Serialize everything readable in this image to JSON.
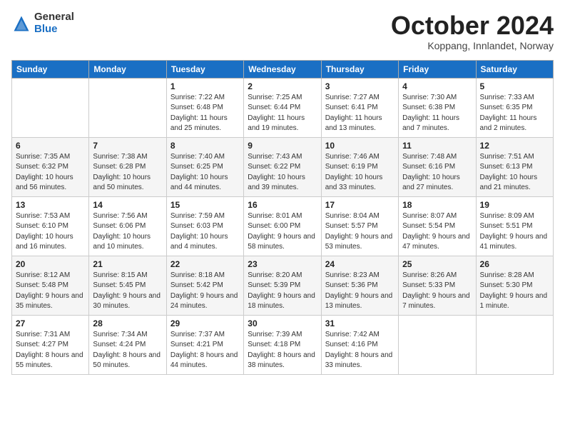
{
  "logo": {
    "general": "General",
    "blue": "Blue"
  },
  "header": {
    "month": "October 2024",
    "location": "Koppang, Innlandet, Norway"
  },
  "weekdays": [
    "Sunday",
    "Monday",
    "Tuesday",
    "Wednesday",
    "Thursday",
    "Friday",
    "Saturday"
  ],
  "weeks": [
    [
      {
        "day": "",
        "info": ""
      },
      {
        "day": "",
        "info": ""
      },
      {
        "day": "1",
        "info": "Sunrise: 7:22 AM\nSunset: 6:48 PM\nDaylight: 11 hours and 25 minutes."
      },
      {
        "day": "2",
        "info": "Sunrise: 7:25 AM\nSunset: 6:44 PM\nDaylight: 11 hours and 19 minutes."
      },
      {
        "day": "3",
        "info": "Sunrise: 7:27 AM\nSunset: 6:41 PM\nDaylight: 11 hours and 13 minutes."
      },
      {
        "day": "4",
        "info": "Sunrise: 7:30 AM\nSunset: 6:38 PM\nDaylight: 11 hours and 7 minutes."
      },
      {
        "day": "5",
        "info": "Sunrise: 7:33 AM\nSunset: 6:35 PM\nDaylight: 11 hours and 2 minutes."
      }
    ],
    [
      {
        "day": "6",
        "info": "Sunrise: 7:35 AM\nSunset: 6:32 PM\nDaylight: 10 hours and 56 minutes."
      },
      {
        "day": "7",
        "info": "Sunrise: 7:38 AM\nSunset: 6:28 PM\nDaylight: 10 hours and 50 minutes."
      },
      {
        "day": "8",
        "info": "Sunrise: 7:40 AM\nSunset: 6:25 PM\nDaylight: 10 hours and 44 minutes."
      },
      {
        "day": "9",
        "info": "Sunrise: 7:43 AM\nSunset: 6:22 PM\nDaylight: 10 hours and 39 minutes."
      },
      {
        "day": "10",
        "info": "Sunrise: 7:46 AM\nSunset: 6:19 PM\nDaylight: 10 hours and 33 minutes."
      },
      {
        "day": "11",
        "info": "Sunrise: 7:48 AM\nSunset: 6:16 PM\nDaylight: 10 hours and 27 minutes."
      },
      {
        "day": "12",
        "info": "Sunrise: 7:51 AM\nSunset: 6:13 PM\nDaylight: 10 hours and 21 minutes."
      }
    ],
    [
      {
        "day": "13",
        "info": "Sunrise: 7:53 AM\nSunset: 6:10 PM\nDaylight: 10 hours and 16 minutes."
      },
      {
        "day": "14",
        "info": "Sunrise: 7:56 AM\nSunset: 6:06 PM\nDaylight: 10 hours and 10 minutes."
      },
      {
        "day": "15",
        "info": "Sunrise: 7:59 AM\nSunset: 6:03 PM\nDaylight: 10 hours and 4 minutes."
      },
      {
        "day": "16",
        "info": "Sunrise: 8:01 AM\nSunset: 6:00 PM\nDaylight: 9 hours and 58 minutes."
      },
      {
        "day": "17",
        "info": "Sunrise: 8:04 AM\nSunset: 5:57 PM\nDaylight: 9 hours and 53 minutes."
      },
      {
        "day": "18",
        "info": "Sunrise: 8:07 AM\nSunset: 5:54 PM\nDaylight: 9 hours and 47 minutes."
      },
      {
        "day": "19",
        "info": "Sunrise: 8:09 AM\nSunset: 5:51 PM\nDaylight: 9 hours and 41 minutes."
      }
    ],
    [
      {
        "day": "20",
        "info": "Sunrise: 8:12 AM\nSunset: 5:48 PM\nDaylight: 9 hours and 35 minutes."
      },
      {
        "day": "21",
        "info": "Sunrise: 8:15 AM\nSunset: 5:45 PM\nDaylight: 9 hours and 30 minutes."
      },
      {
        "day": "22",
        "info": "Sunrise: 8:18 AM\nSunset: 5:42 PM\nDaylight: 9 hours and 24 minutes."
      },
      {
        "day": "23",
        "info": "Sunrise: 8:20 AM\nSunset: 5:39 PM\nDaylight: 9 hours and 18 minutes."
      },
      {
        "day": "24",
        "info": "Sunrise: 8:23 AM\nSunset: 5:36 PM\nDaylight: 9 hours and 13 minutes."
      },
      {
        "day": "25",
        "info": "Sunrise: 8:26 AM\nSunset: 5:33 PM\nDaylight: 9 hours and 7 minutes."
      },
      {
        "day": "26",
        "info": "Sunrise: 8:28 AM\nSunset: 5:30 PM\nDaylight: 9 hours and 1 minute."
      }
    ],
    [
      {
        "day": "27",
        "info": "Sunrise: 7:31 AM\nSunset: 4:27 PM\nDaylight: 8 hours and 55 minutes."
      },
      {
        "day": "28",
        "info": "Sunrise: 7:34 AM\nSunset: 4:24 PM\nDaylight: 8 hours and 50 minutes."
      },
      {
        "day": "29",
        "info": "Sunrise: 7:37 AM\nSunset: 4:21 PM\nDaylight: 8 hours and 44 minutes."
      },
      {
        "day": "30",
        "info": "Sunrise: 7:39 AM\nSunset: 4:18 PM\nDaylight: 8 hours and 38 minutes."
      },
      {
        "day": "31",
        "info": "Sunrise: 7:42 AM\nSunset: 4:16 PM\nDaylight: 8 hours and 33 minutes."
      },
      {
        "day": "",
        "info": ""
      },
      {
        "day": "",
        "info": ""
      }
    ]
  ]
}
